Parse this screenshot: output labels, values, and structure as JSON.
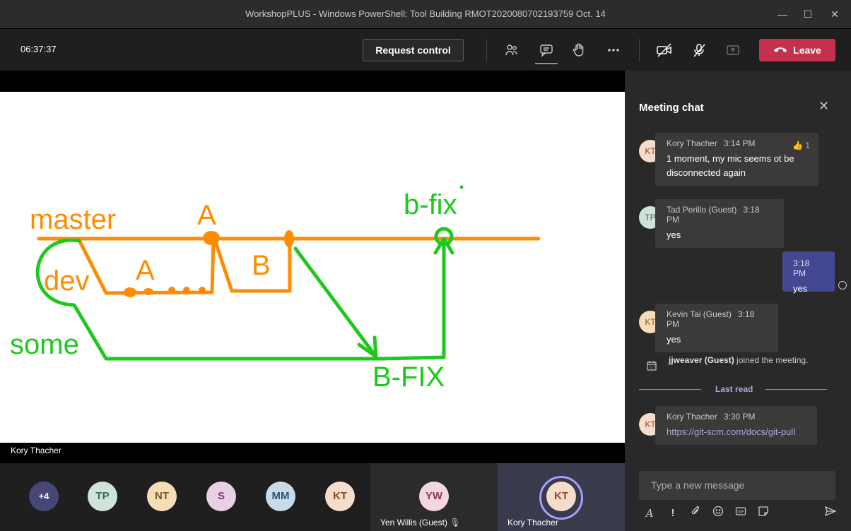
{
  "window": {
    "title": "WorkshopPLUS - Windows PowerShell: Tool Building RMOT2020080702193759 Oct. 14"
  },
  "toolbar": {
    "timer": "06:37:37",
    "request_control": "Request control",
    "leave": "Leave"
  },
  "whiteboard": {
    "labels": {
      "master": "master",
      "dev": "dev",
      "some": "some",
      "a1": "A",
      "a2": "A",
      "b": "B",
      "bfix": "b-fix",
      "bfix_upper": "B-FIX"
    }
  },
  "presenter": "Kory Thacher",
  "roster": {
    "overflow": "+4",
    "people": [
      {
        "initials": "TP",
        "bg": "#cfe3d8",
        "fg": "#3d6b52"
      },
      {
        "initials": "NT",
        "bg": "#f7dcb8",
        "fg": "#7a5a20"
      },
      {
        "initials": "S",
        "bg": "#e8d1e4",
        "fg": "#7a3f72"
      },
      {
        "initials": "MM",
        "bg": "#c9dbe8",
        "fg": "#2f5775"
      },
      {
        "initials": "KT",
        "bg": "#f5dccb",
        "fg": "#8a4c28"
      }
    ],
    "tile1": {
      "initials": "YW",
      "name": "Yen Willis (Guest)"
    },
    "tile2": {
      "initials": "KT",
      "name": "Kory Thacher"
    }
  },
  "chat": {
    "title": "Meeting chat",
    "messages": [
      {
        "initials": "KT",
        "author": "Kory Thacher",
        "time": "3:14 PM",
        "text": "1 moment, my mic seems ot be disconnected again",
        "reaction_count": "1"
      },
      {
        "initials": "TP",
        "author": "Tad Perillo (Guest)",
        "time": "3:18 PM",
        "text": "yes"
      },
      {
        "initials": "KT",
        "author": "Kevin Tai (Guest)",
        "time": "3:18 PM",
        "text": "yes"
      },
      {
        "initials": "KT",
        "author": "Kory Thacher",
        "time": "3:30 PM",
        "text": "https://git-scm.com/docs/git-pull"
      }
    ],
    "mine": {
      "time": "3:18 PM",
      "text": "yes"
    },
    "system": {
      "name": "jjweaver (Guest)",
      "text": " joined the meeting."
    },
    "last_read": "Last read",
    "compose_placeholder": "Type a new message"
  },
  "colors": {
    "accent": "#6264a7",
    "leave": "#c4314b",
    "orange": "#ff8c00",
    "green": "#1ec81e"
  }
}
